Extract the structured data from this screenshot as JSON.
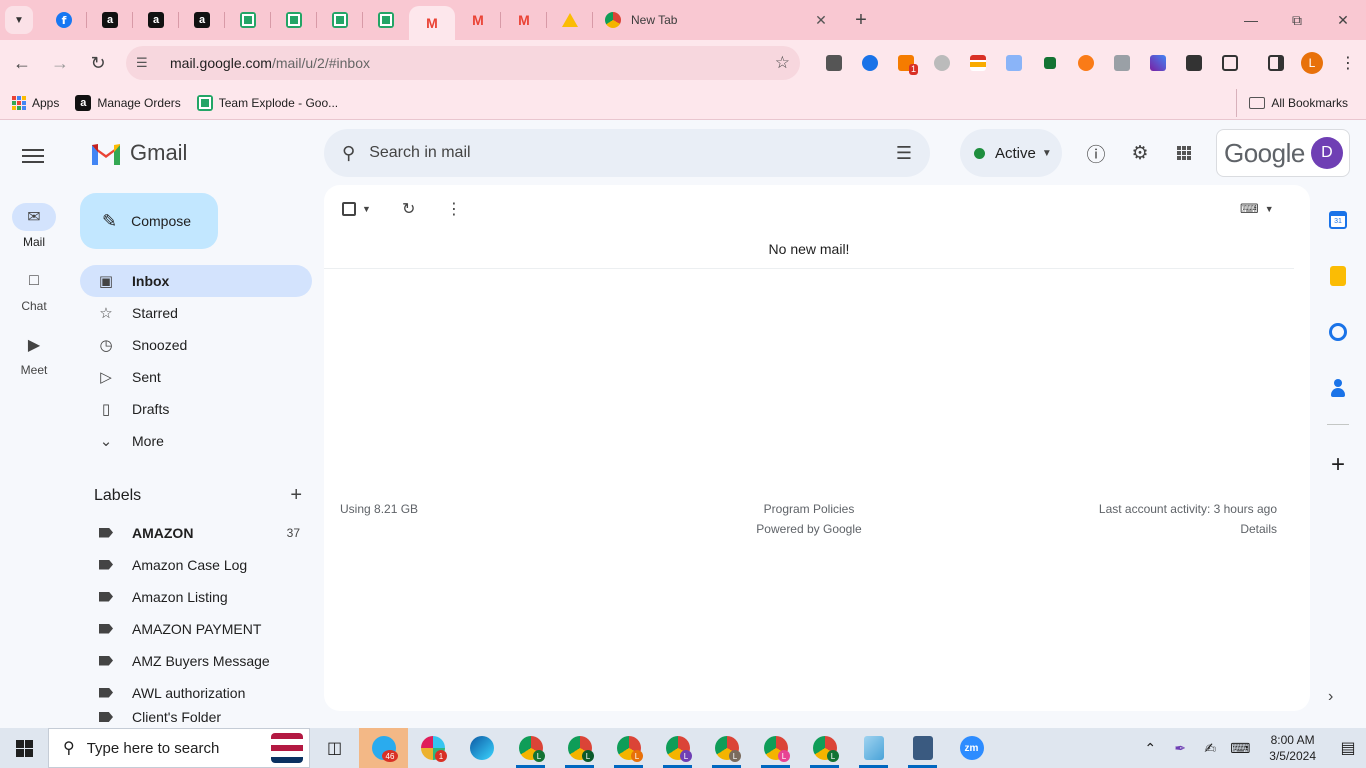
{
  "browser": {
    "tabs": [
      {
        "icon": "facebook-favicon"
      },
      {
        "icon": "amazon-favicon"
      },
      {
        "icon": "amazon-favicon"
      },
      {
        "icon": "amazon-favicon"
      },
      {
        "icon": "google-sheets-favicon"
      },
      {
        "icon": "google-sheets-favicon"
      },
      {
        "icon": "google-sheets-favicon"
      },
      {
        "icon": "google-sheets-favicon"
      },
      {
        "icon": "gmail-favicon",
        "active": true
      },
      {
        "icon": "gmail-favicon"
      },
      {
        "icon": "gmail-favicon"
      },
      {
        "icon": "google-drive-favicon"
      }
    ],
    "new_tab_title": "New Tab",
    "url_host": "mail.google.com",
    "url_path": "/mail/u/2/#inbox",
    "profile_initial": "L",
    "extension_badge": "1",
    "bookmarks": {
      "apps": "Apps",
      "items": [
        "Manage Orders",
        "Team Explode - Goo..."
      ],
      "all": "All Bookmarks"
    }
  },
  "gmail": {
    "logo_text": "Gmail",
    "rail": [
      {
        "label": "Mail",
        "icon": "mail-icon",
        "selected": true
      },
      {
        "label": "Chat",
        "icon": "chat-icon"
      },
      {
        "label": "Meet",
        "icon": "video-icon"
      }
    ],
    "compose_label": "Compose",
    "nav": [
      {
        "label": "Inbox",
        "icon": "inbox-icon",
        "selected": true
      },
      {
        "label": "Starred",
        "icon": "star-icon"
      },
      {
        "label": "Snoozed",
        "icon": "clock-icon"
      },
      {
        "label": "Sent",
        "icon": "send-icon"
      },
      {
        "label": "Drafts",
        "icon": "draft-icon"
      },
      {
        "label": "More",
        "icon": "chevron-down-icon"
      }
    ],
    "labels_heading": "Labels",
    "labels": [
      {
        "name": "AMAZON",
        "count": "37",
        "bold": true
      },
      {
        "name": "Amazon Case Log",
        "count": ""
      },
      {
        "name": "Amazon Listing",
        "count": ""
      },
      {
        "name": "AMAZON PAYMENT",
        "count": ""
      },
      {
        "name": "AMZ Buyers Message",
        "count": ""
      },
      {
        "name": "AWL authorization",
        "count": ""
      },
      {
        "name": "Client's Folder",
        "count": ""
      }
    ],
    "search_placeholder": "Search in mail",
    "status": "Active",
    "account_brand": "Google",
    "account_initial": "D",
    "empty_message": "No new mail!",
    "footer": {
      "storage": "Using 8.21 GB",
      "policies": "Program Policies",
      "powered": "Powered by Google",
      "activity": "Last account activity: 3 hours ago",
      "details": "Details"
    },
    "calendar_day": "31"
  },
  "taskbar": {
    "search_placeholder": "Type here to search",
    "telegram_badge": "46",
    "slack_badge": "1",
    "zoom_label": "zm",
    "time": "8:00 AM",
    "date": "3/5/2024"
  }
}
